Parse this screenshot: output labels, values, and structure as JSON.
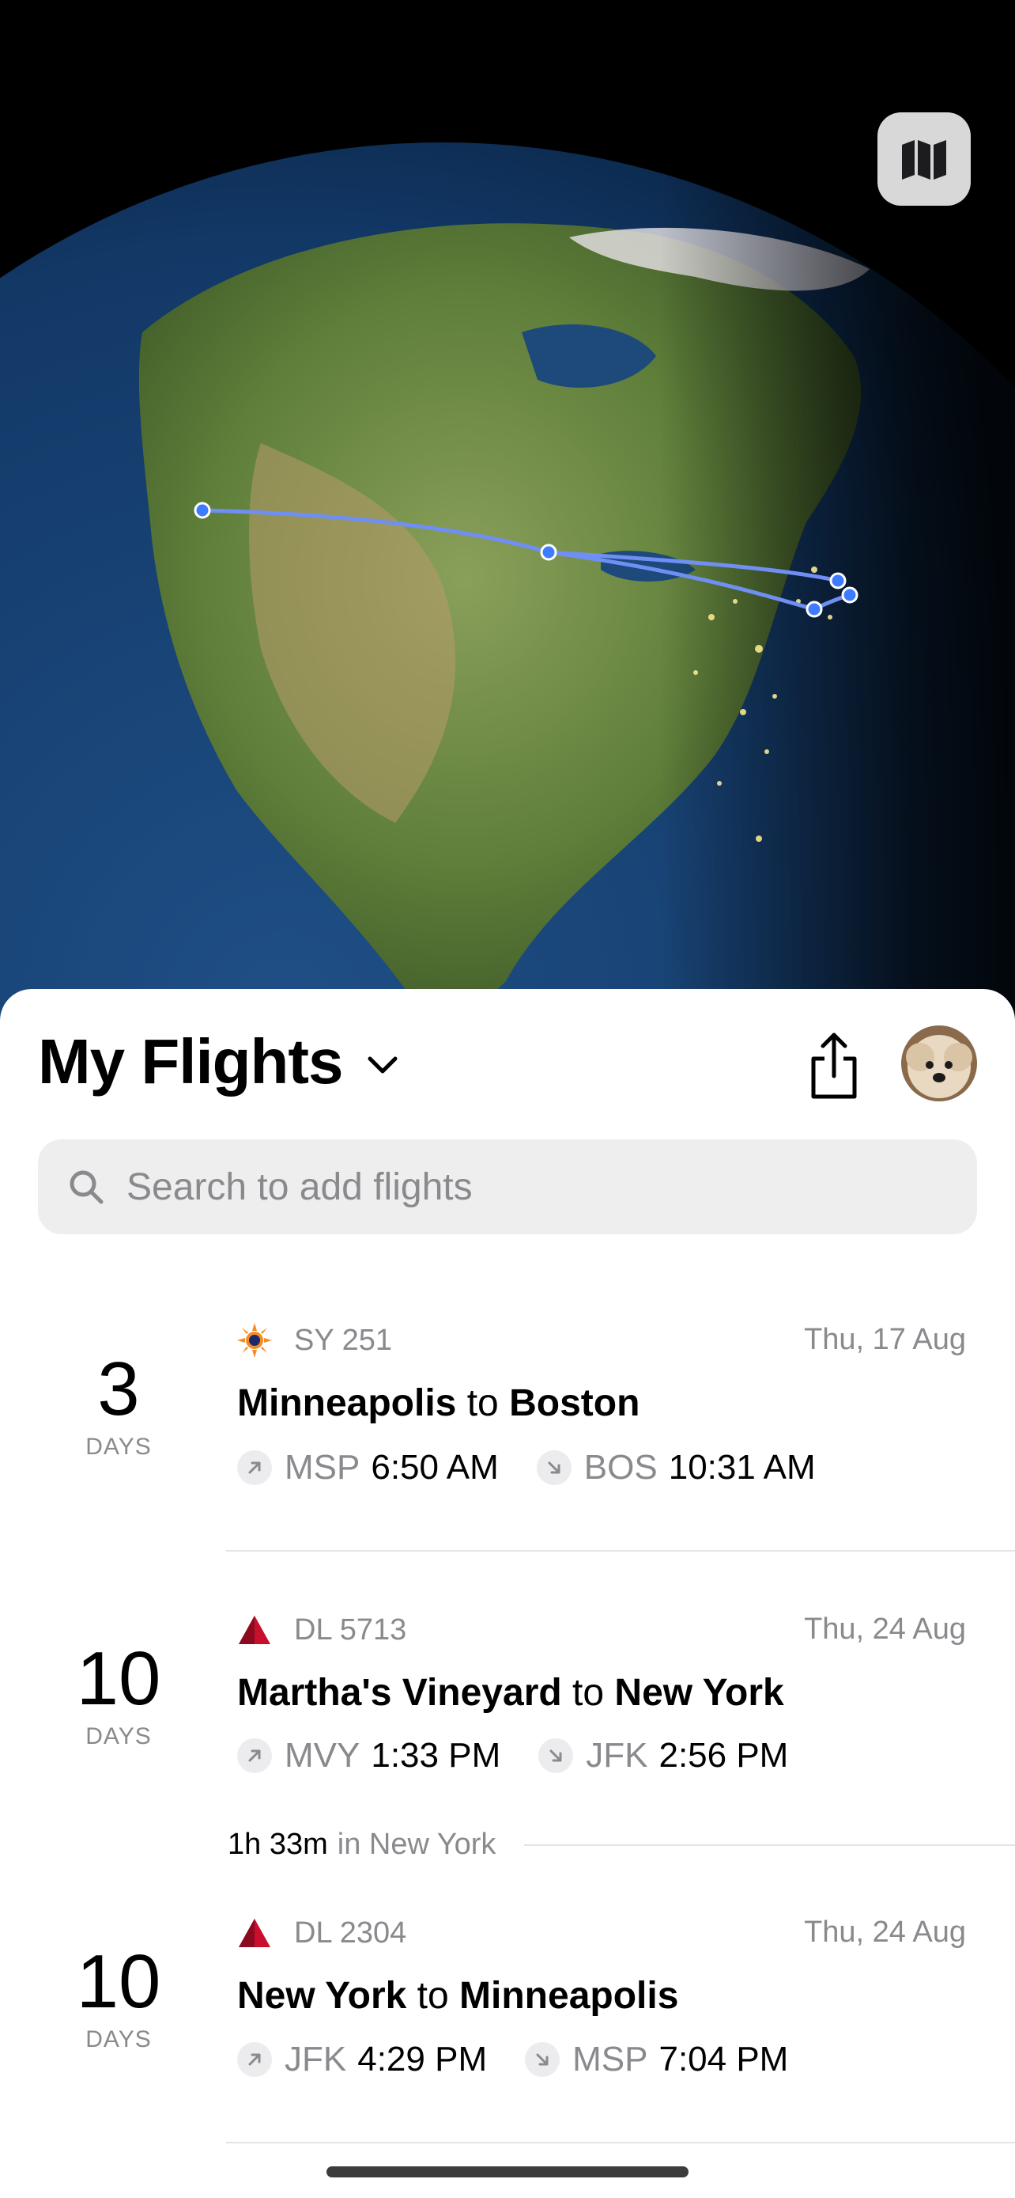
{
  "header": {
    "title": "My Flights"
  },
  "search": {
    "placeholder": "Search to add flights"
  },
  "icons": {
    "map": "map-icon",
    "share": "share-icon",
    "search": "search-icon",
    "chevron": "chevron-down-icon",
    "departure": "arrow-up-right-icon",
    "arrival": "arrow-down-right-icon"
  },
  "colors": {
    "route_line": "#5b7cf0",
    "route_dot": "#2f6bff",
    "delta_red": "#c8102e",
    "sun_country_orange": "#f28c28"
  },
  "flights": [
    {
      "days": "3",
      "days_label": "DAYS",
      "airline_code": "SY 251",
      "date": "Thu, 17 Aug",
      "from_city": "Minneapolis",
      "to_word": "to",
      "to_city": "Boston",
      "dep_code": "MSP",
      "dep_time": "6:50 AM",
      "arr_code": "BOS",
      "arr_time": "10:31 AM"
    },
    {
      "days": "10",
      "days_label": "DAYS",
      "airline_code": "DL 5713",
      "date": "Thu, 24 Aug",
      "from_city": "Martha's Vineyard",
      "to_word": "to",
      "to_city": "New York",
      "dep_code": "MVY",
      "dep_time": "1:33 PM",
      "arr_code": "JFK",
      "arr_time": "2:56 PM"
    },
    {
      "days": "10",
      "days_label": "DAYS",
      "airline_code": "DL 2304",
      "date": "Thu, 24 Aug",
      "from_city": "New York",
      "to_word": "to",
      "to_city": "Minneapolis",
      "dep_code": "JFK",
      "dep_time": "4:29 PM",
      "arr_code": "MSP",
      "arr_time": "7:04 PM"
    }
  ],
  "layover": {
    "duration": "1h 33m",
    "text": "in New York"
  }
}
